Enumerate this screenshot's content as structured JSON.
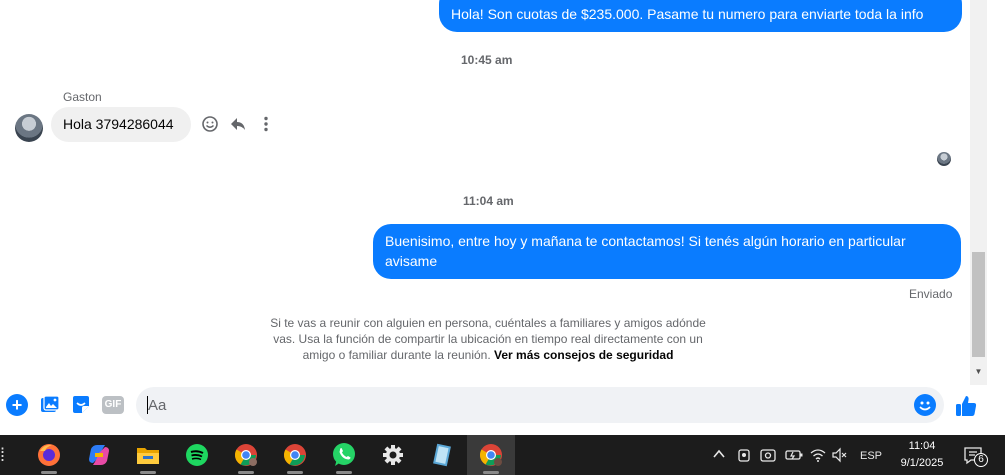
{
  "chat": {
    "messages": {
      "outgoing_top": "Hola! Son cuotas de $235.000. Pasame tu numero para enviarte toda la info",
      "timestamp_1": "10:45 am",
      "incoming_sender": "Gaston",
      "incoming_text": "Hola 3794286044",
      "timestamp_2": "11:04 am",
      "outgoing_main": "Buenisimo, entre hoy y mañana te contactamos! Si tenés algún horario en particular avisame",
      "status": "Enviado"
    },
    "safety_notice": {
      "text": "Si te vas a reunir con alguien en persona, cuéntales a familiares y amigos adónde vas. Usa la función de compartir la ubicación en tiempo real directamente con un amigo o familiar durante la reunión. ",
      "link": "Ver más consejos de seguridad"
    },
    "message_actions": [
      "smiley-icon",
      "reply-icon",
      "more-options-icon"
    ]
  },
  "composer": {
    "placeholder": "Aa",
    "icons": [
      "plus-icon",
      "photo-icon",
      "sticker-icon",
      "gif-icon",
      "emoji-icon",
      "thumbs-up-icon"
    ],
    "gif_label": "GIF",
    "accent_color": "#0a7cff"
  },
  "taskbar": {
    "apps": [
      "firefox-icon",
      "copilot-icon",
      "file-explorer-icon",
      "spotify-icon",
      "chrome-profile-icon",
      "chrome-icon",
      "whatsapp-icon",
      "settings-icon",
      "notepad-icon",
      "chrome-active-icon"
    ],
    "tray": {
      "language": "ESP",
      "time": "11:04",
      "date": "9/1/2025",
      "notification_count": "6"
    }
  }
}
